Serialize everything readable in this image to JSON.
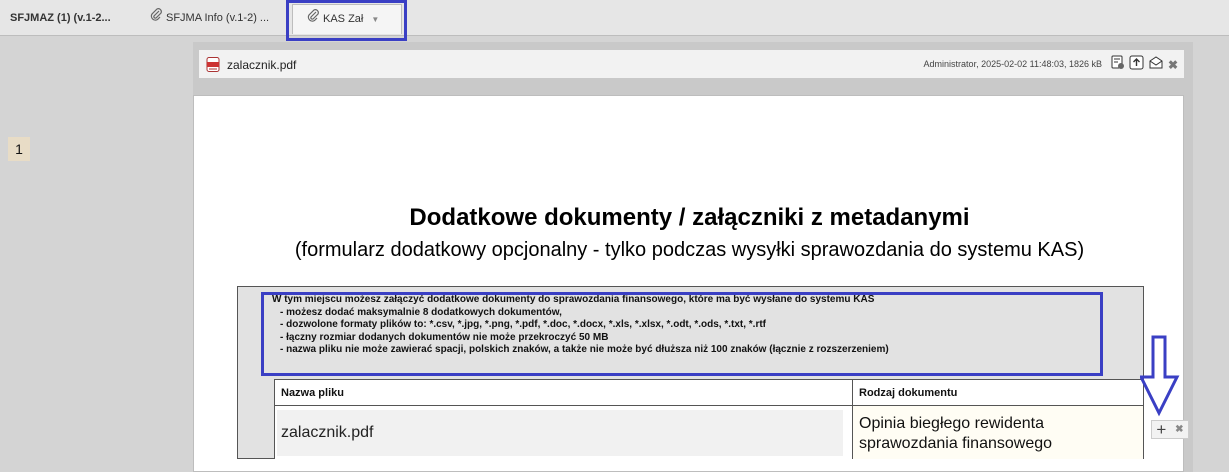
{
  "tabs": [
    {
      "label": "SFJMAZ (1) (v.1-2..."
    },
    {
      "label": "SFJMA Info (v.1-2) ..."
    },
    {
      "label": "KAS Zał"
    }
  ],
  "attachment": {
    "filename": "zalacznik.pdf",
    "meta": "Administrator, 2025-02-02 11:48:03, 1826 kB",
    "icons": [
      "document-settings-icon",
      "upload-icon",
      "email-icon",
      "close-icon"
    ]
  },
  "document": {
    "title": "Dodatkowe dokumenty / załączniki z metadanymi",
    "subtitle": "(formularz dodatkowy opcjonalny - tylko podczas wysyłki sprawozdania do systemu KAS)",
    "info_lines": [
      "W tym miejscu możesz załączyć dodatkowe dokumenty do sprawozdania finansowego, które ma być wysłane do systemu KAS",
      "- możesz dodać maksymalnie 8 dodatkowych dokumentów,",
      "- dozwolone formaty plików to: *.csv, *.jpg, *.png, *.pdf, *.doc, *.docx, *.xls, *.xlsx, *.odt, *.ods, *.txt, *.rtf",
      "- łączny rozmiar dodanych dokumentów nie może przekroczyć 50 MB",
      "- nazwa pliku nie może zawierać spacji, polskich znaków, a także nie może być dłuższa niż 100 znaków (łącznie z rozszerzeniem)"
    ],
    "table": {
      "headers": [
        "Nazwa pliku",
        "Rodzaj dokumentu"
      ],
      "rows": [
        {
          "num": "1",
          "filename": "zalacznik.pdf",
          "doc_type": "Opinia biegłego rewidenta sprawozdania finansowego"
        }
      ]
    }
  },
  "colors": {
    "highlight": "#3a3fc4",
    "background": "#d4d4d4"
  }
}
